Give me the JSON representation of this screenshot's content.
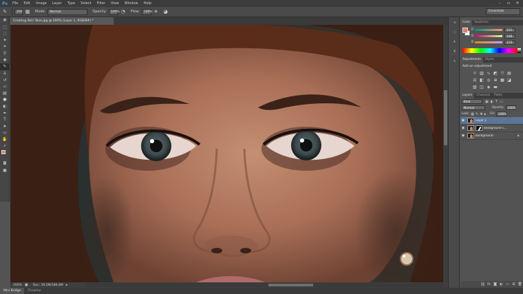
{
  "menubar": {
    "logo": "Ps",
    "items": [
      "File",
      "Edit",
      "Image",
      "Layer",
      "Type",
      "Select",
      "Filter",
      "View",
      "Window",
      "Help"
    ],
    "window_controls": [
      "–",
      "▫",
      "✕"
    ]
  },
  "options": {
    "brush_size": "200",
    "mode_label": "Mode:",
    "mode_value": "Normal",
    "opacity_label": "Opacity:",
    "opacity_value": "100%",
    "flow_label": "Flow:",
    "flow_value": "100%",
    "workspace": "Essentials"
  },
  "document": {
    "tab_title": "Creating Skin Tone.jpg @ 200% (Layer 1, RGB/8#) *",
    "zoom": "200%",
    "doc_info": "Doc: 39.5M/186.8M"
  },
  "bottom_tabs": [
    "Mini Bridge",
    "Timeline"
  ],
  "color_panel": {
    "tabs": [
      "Color",
      "Swatches"
    ],
    "channels": [
      {
        "label": "R",
        "value": "215"
      },
      {
        "label": "G",
        "value": "148"
      },
      {
        "label": "B",
        "value": "119"
      }
    ],
    "fg_color": "#e0806a",
    "bg_color": "#ffffff"
  },
  "adjustments_panel": {
    "tabs": [
      "Adjustments",
      "Styles"
    ],
    "title": "Add an adjustment"
  },
  "layers_panel": {
    "tabs": [
      "Layers",
      "Channels",
      "Paths"
    ],
    "kind_label": "Kind",
    "blend_mode": "Normal",
    "opacity_label": "Opacity:",
    "opacity_value": "100%",
    "lock_label": "Lock:",
    "fill_label": "Fill:",
    "fill_value": "100%",
    "layers": [
      {
        "name": "Layer 1",
        "selected": true
      },
      {
        "name": "Background c...",
        "selected": false
      },
      {
        "name": "Background",
        "selected": false
      }
    ]
  },
  "icon_strip": {
    "items": [
      "history-icon",
      "properties-icon",
      "character-icon",
      "paragraph-icon",
      "brush-presets-icon"
    ]
  },
  "tools": {
    "items": [
      "move-tool-icon",
      "marquee-tool-icon",
      "lasso-tool-icon",
      "quick-select-tool-icon",
      "crop-tool-icon",
      "eyedropper-tool-icon",
      "healing-tool-icon",
      "brush-tool-icon",
      "clone-stamp-tool-icon",
      "history-brush-tool-icon",
      "eraser-tool-icon",
      "gradient-tool-icon",
      "blur-tool-icon",
      "dodge-tool-icon",
      "pen-tool-icon",
      "type-tool-icon",
      "path-select-tool-icon",
      "shape-tool-icon",
      "hand-tool-icon",
      "zoom-tool-icon"
    ]
  }
}
